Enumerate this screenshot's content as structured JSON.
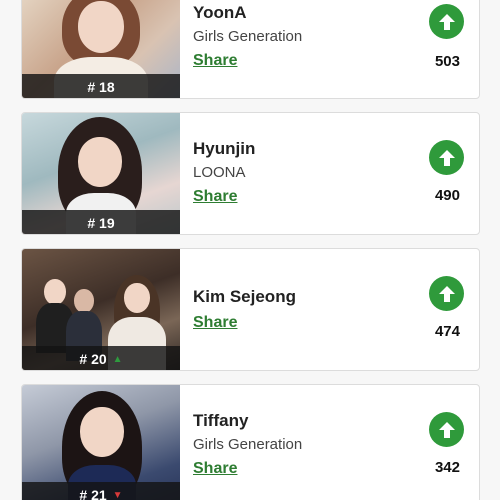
{
  "idols": [
    {
      "rank": "# 18",
      "name": "YoonA",
      "group": "Girls Generation",
      "share_label": "Share",
      "votes": "503",
      "trend": "none"
    },
    {
      "rank": "# 19",
      "name": "Hyunjin",
      "group": "LOONA",
      "share_label": "Share",
      "votes": "490",
      "trend": "none"
    },
    {
      "rank": "# 20",
      "name": "Kim Sejeong",
      "group": "",
      "share_label": "Share",
      "votes": "474",
      "trend": "up"
    },
    {
      "rank": "# 21",
      "name": "Tiffany",
      "group": "Girls Generation",
      "share_label": "Share",
      "votes": "342",
      "trend": "down"
    }
  ],
  "icons": {
    "vote": "arrow-up-circle-icon",
    "trend_up": "triangle-up-icon",
    "trend_down": "triangle-down-icon"
  },
  "colors": {
    "accent_green": "#2f9a3b",
    "share_green": "#2e7d32",
    "trend_down": "#d93a3a"
  }
}
